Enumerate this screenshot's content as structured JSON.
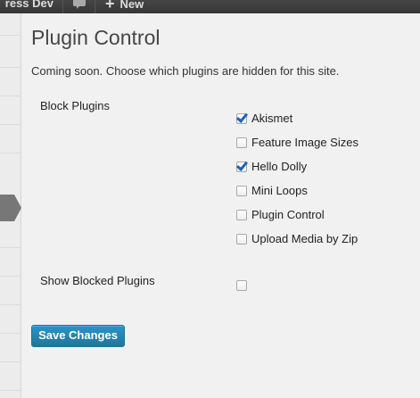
{
  "adminbar": {
    "site_label": "ress Dev",
    "new_label": "New",
    "icons": [
      "comment-icon",
      "plus-icon"
    ]
  },
  "page": {
    "title": "Plugin Control",
    "intro": "Coming soon. Choose which plugins are hidden for this site."
  },
  "block_plugins": {
    "label": "Block Plugins",
    "items": [
      {
        "name": "Akismet",
        "checked": true
      },
      {
        "name": "Feature Image Sizes",
        "checked": false
      },
      {
        "name": "Hello Dolly",
        "checked": true
      },
      {
        "name": "Mini Loops",
        "checked": false
      },
      {
        "name": "Plugin Control",
        "checked": false
      },
      {
        "name": "Upload Media by Zip",
        "checked": false
      }
    ]
  },
  "show_blocked": {
    "label": "Show Blocked Plugins",
    "checked": false
  },
  "save_button": {
    "label": "Save Changes"
  },
  "colors": {
    "adminbar_bg": "#464646",
    "button_bg": "#2a95c5",
    "checkmark": "#1e63b8",
    "title_text": "#464646"
  }
}
